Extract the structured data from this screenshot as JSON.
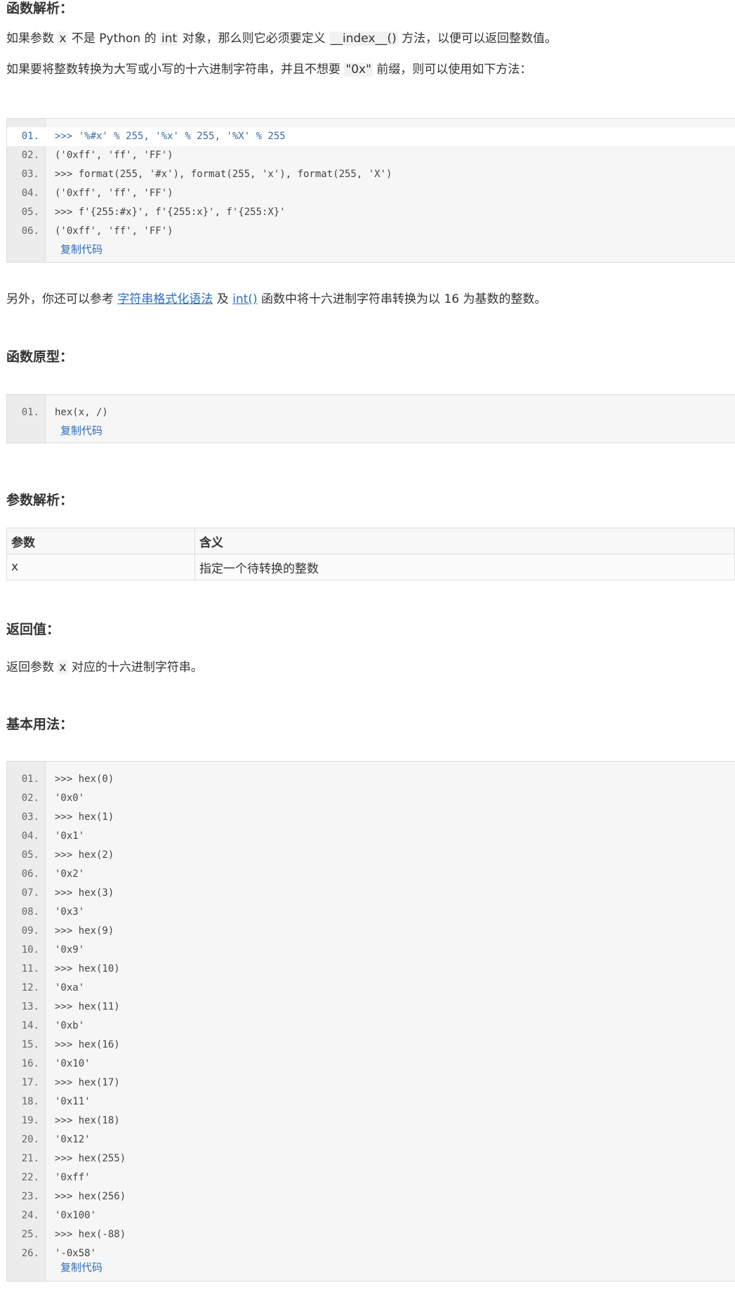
{
  "sections": {
    "analysis_title": "函数解析：",
    "prototype_title": "函数原型：",
    "params_title": "参数解析：",
    "return_title": "返回值：",
    "usage_title": "基本用法："
  },
  "paragraphs": {
    "p1": {
      "a": "如果参数 ",
      "c1": "x",
      "b": " 不是 Python 的 ",
      "c2": "int",
      "c": " 对象，那么则它必须要定义 ",
      "c3": "__index__()",
      "d": " 方法，以便可以返回整数值。"
    },
    "p2": {
      "a": "如果要将整数转换为大写或小写的十六进制字符串，并且不想要 ",
      "c1": "\"0x\"",
      "b": " 前缀，则可以使用如下方法："
    },
    "p3": {
      "a": "另外，你还可以参考 ",
      "link1": "字符串格式化语法",
      "b": " 及 ",
      "link2": "int()",
      "c": " 函数中将十六进制字符串转换为以 16 为基数的整数。"
    },
    "p4": {
      "a": "返回参数 ",
      "c1": "x",
      "b": " 对应的十六进制字符串。"
    }
  },
  "code_blocks": {
    "example1": {
      "lines": [
        {
          "num": "01.",
          "code": ">>> '%#x' % 255, '%x' % 255, '%X' % 255"
        },
        {
          "num": "02.",
          "code": "('0xff', 'ff', 'FF')"
        },
        {
          "num": "03.",
          "code": ">>> format(255, '#x'), format(255, 'x'), format(255, 'X')"
        },
        {
          "num": "04.",
          "code": "('0xff', 'ff', 'FF')"
        },
        {
          "num": "05.",
          "code": ">>> f'{255:#x}', f'{255:x}', f'{255:X}'"
        },
        {
          "num": "06.",
          "code": "('0xff', 'ff', 'FF')"
        }
      ],
      "copy_label": "复制代码"
    },
    "prototype": {
      "lines": [
        {
          "num": "01.",
          "code": "hex(x, /)"
        }
      ],
      "copy_label": "复制代码"
    },
    "usage": {
      "lines": [
        {
          "num": "01.",
          "code": ">>> hex(0)"
        },
        {
          "num": "02.",
          "code": "'0x0'"
        },
        {
          "num": "03.",
          "code": ">>> hex(1)"
        },
        {
          "num": "04.",
          "code": "'0x1'"
        },
        {
          "num": "05.",
          "code": ">>> hex(2)"
        },
        {
          "num": "06.",
          "code": "'0x2'"
        },
        {
          "num": "07.",
          "code": ">>> hex(3)"
        },
        {
          "num": "08.",
          "code": "'0x3'"
        },
        {
          "num": "09.",
          "code": ">>> hex(9)"
        },
        {
          "num": "10.",
          "code": "'0x9'"
        },
        {
          "num": "11.",
          "code": ">>> hex(10)"
        },
        {
          "num": "12.",
          "code": "'0xa'"
        },
        {
          "num": "13.",
          "code": ">>> hex(11)"
        },
        {
          "num": "14.",
          "code": "'0xb'"
        },
        {
          "num": "15.",
          "code": ">>> hex(16)"
        },
        {
          "num": "16.",
          "code": "'0x10'"
        },
        {
          "num": "17.",
          "code": ">>> hex(17)"
        },
        {
          "num": "18.",
          "code": "'0x11'"
        },
        {
          "num": "19.",
          "code": ">>> hex(18)"
        },
        {
          "num": "20.",
          "code": "'0x12'"
        },
        {
          "num": "21.",
          "code": ">>> hex(255)"
        },
        {
          "num": "22.",
          "code": "'0xff'"
        },
        {
          "num": "23.",
          "code": ">>> hex(256)"
        },
        {
          "num": "24.",
          "code": "'0x100'"
        },
        {
          "num": "25.",
          "code": ">>> hex(-88)"
        },
        {
          "num": "26.",
          "code": "'-0x58'"
        }
      ],
      "copy_label": "复制代码"
    }
  },
  "params_table": {
    "headers": [
      "参数",
      "含义"
    ],
    "rows": [
      [
        "x",
        "指定一个待转换的整数"
      ]
    ]
  },
  "colors": {
    "link": "#2a6ebb",
    "code_bg": "#f6f6f6",
    "gutter_bg": "#ececec",
    "border": "#dddddd"
  }
}
